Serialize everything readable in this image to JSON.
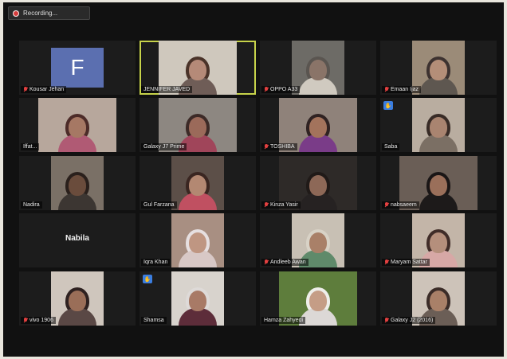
{
  "recording": {
    "label": "Recording..."
  },
  "tiles": [
    {
      "name": "Kousar Jehan",
      "muted": true,
      "type": "avatar",
      "letter": "F",
      "avatar_color": "#5b6fb0"
    },
    {
      "name": "JENNIFER JAVED",
      "muted": false,
      "type": "video",
      "active": true,
      "bg": "#cfc8bd",
      "skin": "#b58a78",
      "cloth": "#6f5d57",
      "hair": "#4a3329",
      "frame": "wide"
    },
    {
      "name": "OPPO A33",
      "muted": true,
      "type": "video",
      "bg": "#6d6b66",
      "skin": "#8a7468",
      "cloth": "#d0cac0",
      "hair": "#5a5550",
      "frame": "mid"
    },
    {
      "name": "Emaan Ijaz",
      "muted": true,
      "type": "video",
      "bg": "#9b8b78",
      "skin": "#b48e78",
      "cloth": "#5e5750",
      "hair": "#3d3230",
      "frame": "mid"
    },
    {
      "name": "Iffat...",
      "muted": false,
      "type": "video",
      "bg": "#b7a79c",
      "skin": "#a67864",
      "cloth": "#b05a74",
      "hair": "#4c2b28",
      "frame": "wide"
    },
    {
      "name": "Galaxy J7 Prime",
      "muted": false,
      "type": "video",
      "bg": "#8d8781",
      "skin": "#9b6a5a",
      "cloth": "#a0455a",
      "hair": "#3c2a27",
      "frame": "wide"
    },
    {
      "name": "TOSHIBA",
      "muted": true,
      "type": "video",
      "bg": "#8f827a",
      "skin": "#a3735c",
      "cloth": "#7a3c88",
      "hair": "#2f2222",
      "frame": "wide"
    },
    {
      "name": "Saba",
      "muted": false,
      "type": "video",
      "hand": true,
      "bg": "#b9ada0",
      "skin": "#a98470",
      "cloth": "#7b6f64",
      "hair": "#382b26",
      "frame": "mid"
    },
    {
      "name": "Nadira",
      "muted": false,
      "type": "video",
      "bg": "#7a7066",
      "skin": "#6a4c3c",
      "cloth": "#3c3632",
      "hair": "#2a201c",
      "frame": "mid"
    },
    {
      "name": "Gul Farzana",
      "muted": false,
      "type": "video",
      "bg": "#5c4f48",
      "skin": "#b38872",
      "cloth": "#c05061",
      "hair": "#3a2621",
      "frame": "mid"
    },
    {
      "name": "Kinza Yasir",
      "muted": true,
      "type": "video",
      "bg": "#2e2a28",
      "skin": "#8d6857",
      "cloth": "#262222",
      "hair": "#201a18",
      "frame": "wide"
    },
    {
      "name": "nabsaeem",
      "muted": true,
      "type": "video",
      "bg": "#6a5e56",
      "skin": "#9a6f5a",
      "cloth": "#1d1a1a",
      "hair": "#1a1616",
      "frame": "wide"
    },
    {
      "name": "Nabila",
      "muted": false,
      "type": "name-only"
    },
    {
      "name": "Iqra Khan",
      "muted": false,
      "type": "video",
      "bg": "#a88f82",
      "skin": "#bf9682",
      "cloth": "#d8c8c6",
      "hair": "#e6dfe0",
      "frame": "mid"
    },
    {
      "name": "Andleeb Awan",
      "muted": true,
      "type": "video",
      "bg": "#c8c0b4",
      "skin": "#a98068",
      "cloth": "#5f8a6a",
      "hair": "#d8d2c6",
      "frame": "mid"
    },
    {
      "name": "Maryam Sattar",
      "muted": true,
      "type": "video",
      "bg": "#c3b5a8",
      "skin": "#b58f7c",
      "cloth": "#d7a8a6",
      "hair": "#402c28",
      "frame": "mid"
    },
    {
      "name": "vivo 1906",
      "muted": true,
      "type": "video",
      "bg": "#cfc6bd",
      "skin": "#9a6e58",
      "cloth": "#5a4845",
      "hair": "#2e2120",
      "frame": "mid"
    },
    {
      "name": "Shamsa",
      "muted": false,
      "type": "video",
      "hand": true,
      "bg": "#d8d3cd",
      "skin": "#a87a66",
      "cloth": "#5d2d3a",
      "hair": "#dedad8",
      "frame": "mid"
    },
    {
      "name": "Hamza Zahyedi",
      "muted": false,
      "type": "video",
      "bg": "#5e7d3c",
      "skin": "#c59d86",
      "cloth": "#dcd8d6",
      "hair": "#eeeeea",
      "frame": "wide"
    },
    {
      "name": "Galaxy J2 (2016)",
      "muted": true,
      "type": "video",
      "bg": "#cdc3b9",
      "skin": "#a98068",
      "cloth": "#6b5e56",
      "hair": "#3b2c28",
      "frame": "mid"
    }
  ]
}
